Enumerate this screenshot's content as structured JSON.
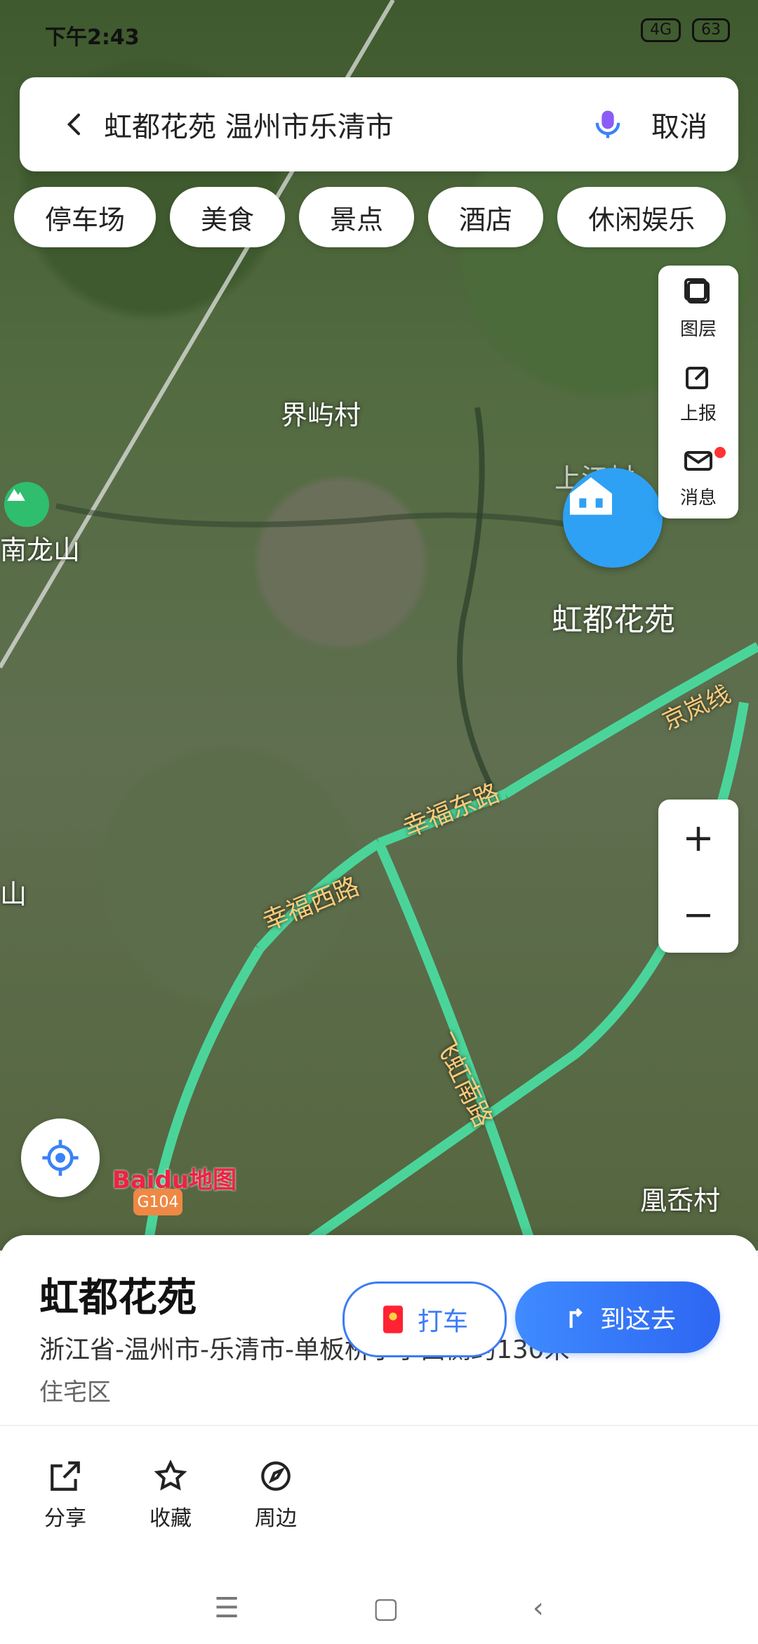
{
  "status": {
    "time": "下午2:43",
    "signal_label": "4G",
    "battery": "63"
  },
  "search": {
    "query": "虹都花苑 温州市乐清市",
    "cancel": "取消"
  },
  "chips": [
    "停车场",
    "美食",
    "景点",
    "酒店",
    "休闲娱乐"
  ],
  "tools": [
    {
      "label": "图层"
    },
    {
      "label": "上报"
    },
    {
      "label": "消息"
    }
  ],
  "zoom": {
    "plus": "+",
    "minus": "−"
  },
  "map_labels": {
    "village_1": "界屿村",
    "mountain": "南龙山",
    "mountain_cut": "山",
    "village_2": "上江村",
    "village_3": "凰岙村",
    "road_1": "幸福西路",
    "road_2": "幸福东路",
    "road_3": "京岚线",
    "road_4": "飞虹南路",
    "pin_name": "虹都花苑"
  },
  "brand": {
    "baidu": "Baidu地图",
    "route": "G104"
  },
  "place": {
    "name": "虹都花苑",
    "address": "浙江省-温州市-乐清市-单板桥小学西侧约130米",
    "type": "住宅区"
  },
  "actions": {
    "share": "分享",
    "favorite": "收藏",
    "nearby": "周边",
    "taxi": "打车",
    "go": "到这去"
  },
  "nav": {
    "menu": "☰",
    "home": "▢",
    "back": "‹"
  }
}
